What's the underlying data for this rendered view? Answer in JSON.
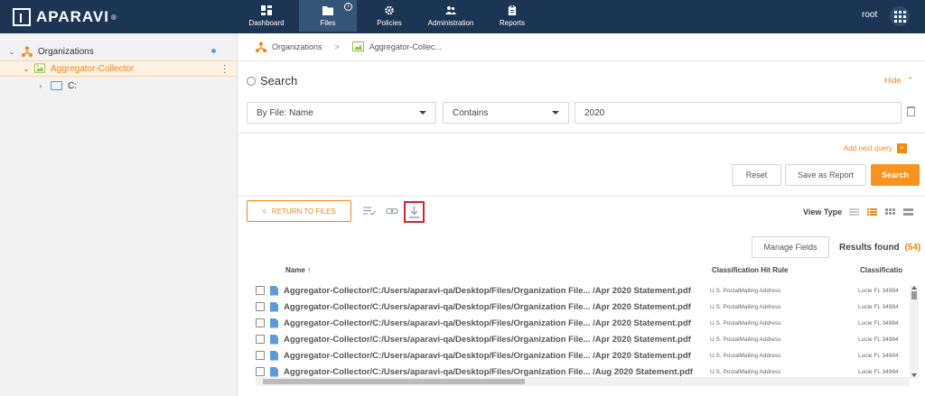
{
  "header": {
    "logo_text": "APARAVI",
    "logo_mark": "®",
    "nav": [
      {
        "label": "Dashboard",
        "icon": "dashboard-icon",
        "active": false
      },
      {
        "label": "Files",
        "icon": "folder-icon",
        "active": true,
        "info": "i"
      },
      {
        "label": "Policies",
        "icon": "gear-icon",
        "active": false
      },
      {
        "label": "Administration",
        "icon": "users-icon",
        "active": false
      },
      {
        "label": "Reports",
        "icon": "clipboard-icon",
        "active": false
      }
    ],
    "user": "root",
    "colors": {
      "bar": "#1c3554",
      "active": "#355578",
      "accent": "#f5870f"
    }
  },
  "sidebar": {
    "items": [
      {
        "label": "Organizations",
        "icon": "organization-icon",
        "expanded": true
      },
      {
        "label": "Aggregator-Collector",
        "icon": "aggregator-icon",
        "selected": true
      },
      {
        "label": "C:",
        "icon": "folder-icon"
      }
    ]
  },
  "breadcrumb": {
    "items": [
      "Organizations",
      "Aggregator-Collec..."
    ],
    "separator": ">"
  },
  "search": {
    "title": "Search",
    "hide_label": "Hide",
    "field_select": "By File: Name",
    "operator_select": "Contains",
    "value": "2020",
    "add_query_label": "Add next query",
    "add_query_plus": "+",
    "reset_label": "Reset",
    "save_report_label": "Save as Report",
    "search_label": "Search"
  },
  "toolbar": {
    "return_label": "RETURN TO FILES",
    "return_chevron": "<",
    "view_type_label": "View Type",
    "manage_fields_label": "Manage Fields",
    "results_label": "Results found",
    "results_count": "(54)"
  },
  "table": {
    "columns": [
      "Name",
      "Classification Hit Rule",
      "Classificatio"
    ],
    "sort_indicator": "↑",
    "rows": [
      {
        "name": "Aggregator-Collector/C:/Users/aparavi-qa/Desktop/Files/Organization File... /Apr 2020 Statement.pdf",
        "hit": "U.S. PostalMailing Address",
        "cls": "Lucie FL 34984"
      },
      {
        "name": "Aggregator-Collector/C:/Users/aparavi-qa/Desktop/Files/Organization File... /Apr 2020 Statement.pdf",
        "hit": "U.S. PostalMailing Address",
        "cls": "Lucie FL 34984"
      },
      {
        "name": "Aggregator-Collector/C:/Users/aparavi-qa/Desktop/Files/Organization File... /Apr 2020 Statement.pdf",
        "hit": "U.S. PostalMailing Address",
        "cls": "Lucie FL 34984"
      },
      {
        "name": "Aggregator-Collector/C:/Users/aparavi-qa/Desktop/Files/Organization File... /Apr 2020 Statement.pdf",
        "hit": "U.S. PostalMailing Address",
        "cls": "Lucie FL 34984"
      },
      {
        "name": "Aggregator-Collector/C:/Users/aparavi-qa/Desktop/Files/Organization File... /Apr 2020 Statement.pdf",
        "hit": "U.S. PostalMailing Address",
        "cls": "Lucie FL 34984"
      },
      {
        "name": "Aggregator-Collector/C:/Users/aparavi-qa/Desktop/Files/Organization File... /Aug 2020 Statement.pdf",
        "hit": "U.S. PostalMailing Address",
        "cls": "Lucie FL 34984"
      }
    ]
  }
}
